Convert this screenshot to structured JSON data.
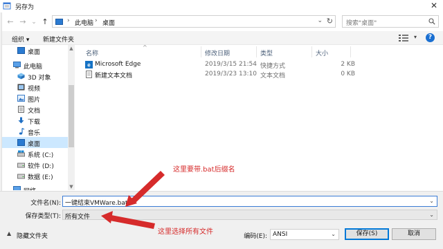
{
  "window": {
    "title": "另存为",
    "close_symbol": "✕"
  },
  "nav": {
    "back": "←",
    "forward": "→",
    "recent": "⌄",
    "up": "↑"
  },
  "address": {
    "separator": "›",
    "segments": [
      "此电脑",
      "桌面"
    ],
    "dropdown": "⌄",
    "refresh": "↻"
  },
  "search": {
    "placeholder": "搜索\"桌面\""
  },
  "toolbar": {
    "organize": "组织 ▾",
    "new_folder": "新建文件夹",
    "view_dd": "▾",
    "help": "?"
  },
  "sidebar": {
    "items": [
      {
        "label": "桌面",
        "icon": "desktop-icon"
      },
      {
        "label": "此电脑",
        "icon": "computer-icon"
      },
      {
        "label": "3D 对象",
        "icon": "3d-objects-icon"
      },
      {
        "label": "视频",
        "icon": "video-icon"
      },
      {
        "label": "图片",
        "icon": "pictures-icon"
      },
      {
        "label": "文档",
        "icon": "documents-icon"
      },
      {
        "label": "下载",
        "icon": "downloads-icon"
      },
      {
        "label": "音乐",
        "icon": "music-icon"
      },
      {
        "label": "桌面",
        "icon": "desktop-icon"
      },
      {
        "label": "系统 (C:)",
        "icon": "drive-icon"
      },
      {
        "label": "软件 (D:)",
        "icon": "drive-icon"
      },
      {
        "label": "数据 (E:)",
        "icon": "drive-icon"
      },
      {
        "label": "网络",
        "icon": "network-icon"
      }
    ]
  },
  "columns": {
    "name": "名称",
    "modified": "修改日期",
    "type": "类型",
    "size": "大小"
  },
  "files": [
    {
      "name": "Microsoft Edge",
      "modified": "2019/3/15 21:54",
      "type": "快捷方式",
      "size": "2 KB",
      "icon": "edge-shortcut-icon"
    },
    {
      "name": "新建文本文档",
      "modified": "2019/3/23 13:10",
      "type": "文本文档",
      "size": "0 KB",
      "icon": "text-file-icon"
    }
  ],
  "form": {
    "filename_label": "文件名(N):",
    "filename_value": "一键结束VMWare.bat",
    "filetype_label": "保存类型(T):",
    "filetype_value": "所有文件",
    "encoding_label": "编码(E):",
    "encoding_value": "ANSI",
    "save": "保存(S)",
    "cancel": "取消",
    "hide_folders": "隐藏文件夹",
    "dd": "⌄"
  },
  "annotations": {
    "top": "这里要带.bat后缀名",
    "bottom": "这里选择所有文件",
    "color": "#d62b2b"
  }
}
